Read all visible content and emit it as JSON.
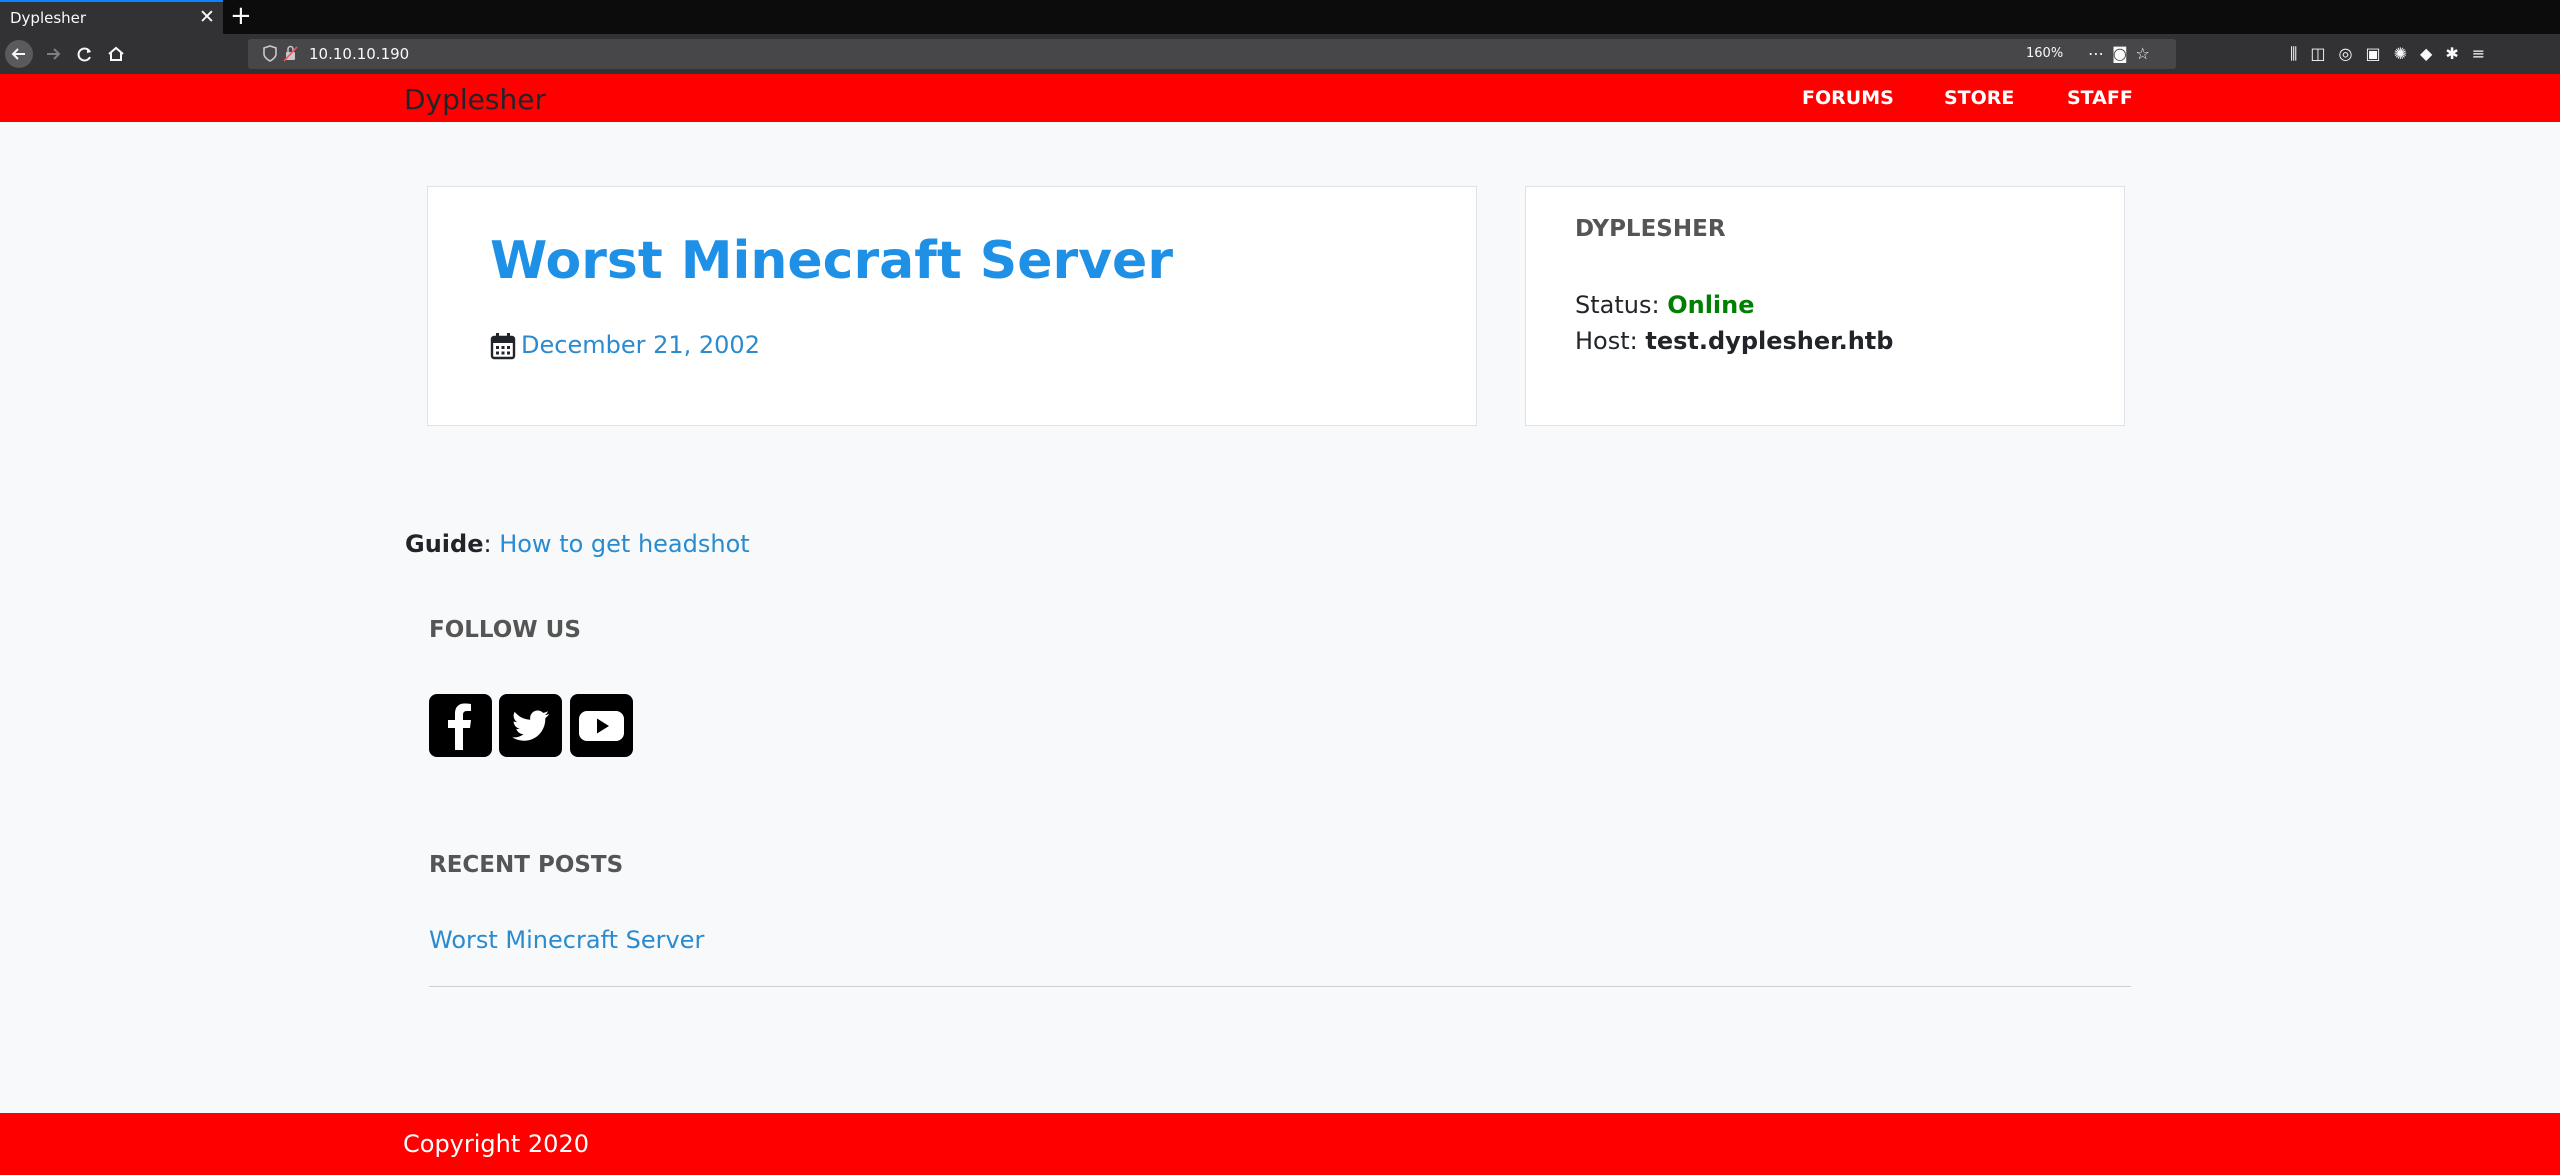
{
  "browser": {
    "tab_title": "Dyplesher",
    "tab_close_glyph": "✕",
    "new_tab_glyph": "+",
    "url": "10.10.10.190",
    "zoom": "160%",
    "icons": {
      "back": "back-arrow-icon",
      "forward": "forward-arrow-icon",
      "reload": "reload-icon",
      "home": "home-icon",
      "tracking": "shield-icon",
      "connection": "insecure-lock-icon",
      "page_actions": "ellipsis-icon",
      "pocket": "pocket-icon",
      "bookmark": "star-icon",
      "library": "library-icon",
      "sidebar": "sidebar-icon",
      "extensions": [
        "extension-icon-1",
        "extension-icon-2",
        "extension-icon-3",
        "extension-icon-4",
        "extension-icon-5"
      ],
      "menu": "hamburger-menu-icon"
    }
  },
  "site": {
    "brand": "Dyplesher",
    "nav": [
      "FORUMS",
      "STORE",
      "STAFF"
    ],
    "post": {
      "title": "Worst Minecraft Server",
      "date": "December 21, 2002"
    },
    "server": {
      "name": "DYPLESHER",
      "status_label": "Status:",
      "status_value": "Online",
      "host_label": "Host:",
      "host_value": "test.dyplesher.htb"
    },
    "guide": {
      "label": "Guide",
      "separator": ":",
      "link_text": "How to get headshot"
    },
    "follow_heading": "FOLLOW US",
    "social": [
      "facebook-icon",
      "twitter-icon",
      "youtube-icon"
    ],
    "recent_heading": "RECENT POSTS",
    "recent_posts": [
      "Worst Minecraft Server"
    ],
    "copyright": "Copyright 2020"
  },
  "colors": {
    "brand_red": "#ff0000",
    "link_blue": "#2a8bd0",
    "title_blue": "#1e90e6",
    "status_green": "#008000",
    "background": "#f8f9fa"
  }
}
